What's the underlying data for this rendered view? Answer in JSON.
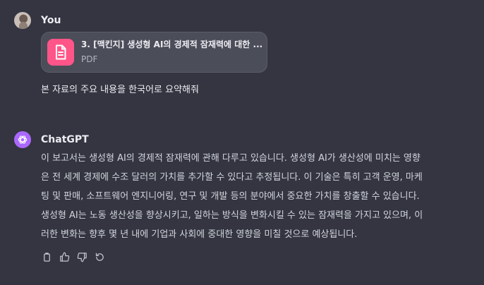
{
  "conversation": {
    "user": {
      "name": "You",
      "attachment": {
        "file_name": "3. [맥킨지] 생성형 AI의 경제적 잠재력에 대한 ...",
        "file_type": "PDF"
      },
      "message": "본 자료의 주요 내용을 한국어로 요약해줘"
    },
    "assistant": {
      "name": "ChatGPT",
      "answer_lines": [
        "이 보고서는 생성형 AI의 경제적 잠재력에 관해 다루고 있습니다. 생성형 AI가 생산성에 미치는 영향",
        "은 전 세계 경제에 수조 달러의 가치를 추가할 수 있다고 추정됩니다. 이 기술은 특히 고객 운영, 마케",
        "팅 및 판매, 소프트웨어 엔지니어링, 연구 및 개발 등의 분야에서 중요한 가치를 창출할 수 있습니다.",
        "생성형 AI는 노동 생산성을 향상시키고, 일하는 방식을 변화시킬 수 있는 잠재력을 가지고 있으며, 이",
        "러한 변화는 향후 몇 년 내에 기업과 사회에 중대한 영향을 미칠 것으로 예상됩니다."
      ],
      "action_icons": [
        "copy-icon",
        "thumbs-up-icon",
        "thumbs-down-icon",
        "regenerate-icon"
      ]
    }
  },
  "colors": {
    "background": "#343541",
    "text": "#ececf1",
    "file_icon": "#ff5588",
    "assistant_avatar": "#ab68ff"
  }
}
